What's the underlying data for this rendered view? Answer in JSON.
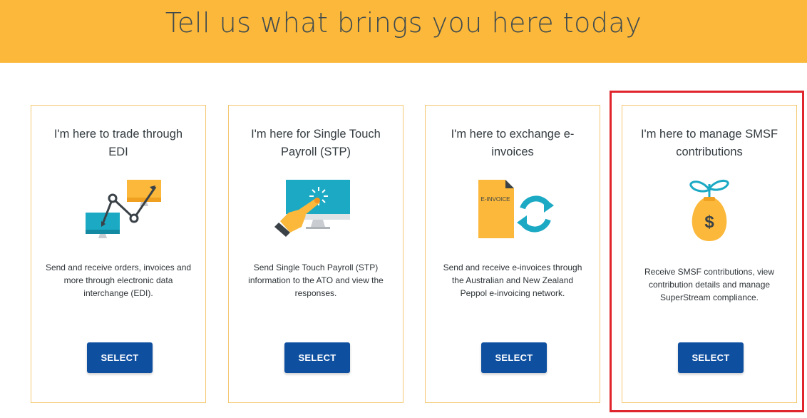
{
  "header": {
    "title": "Tell us what brings you here today"
  },
  "cards": [
    {
      "title": "I'm here to trade through EDI",
      "illustration": "edi-trade-icon",
      "description": "Send and receive orders, invoices and more through electronic data interchange (EDI).",
      "button_label": "SELECT"
    },
    {
      "title": "I'm here for Single Touch Payroll (STP)",
      "illustration": "stp-touch-icon",
      "description": "Send Single Touch Payroll (STP) information to the ATO and view the responses.",
      "button_label": "SELECT"
    },
    {
      "title": "I'm here to exchange e-invoices",
      "illustration": "e-invoice-icon",
      "illustration_label": "E-INVOICE",
      "description": "Send and receive e-invoices through the Australian and New Zealand Peppol e-invoicing network.",
      "button_label": "SELECT"
    },
    {
      "title": "I'm here to manage SMSF contributions",
      "illustration": "smsf-money-bag-icon",
      "illustration_label": "$",
      "description": "Receive SMSF contributions, view contribution details and manage SuperStream compliance.",
      "button_label": "SELECT",
      "highlighted": true
    }
  ],
  "colors": {
    "banner": "#fbb83a",
    "title_text": "#3f4a4f",
    "card_border": "#f5c872",
    "button": "#0e4fa0",
    "teal": "#1ba9c4",
    "highlight": "#e0242c"
  }
}
